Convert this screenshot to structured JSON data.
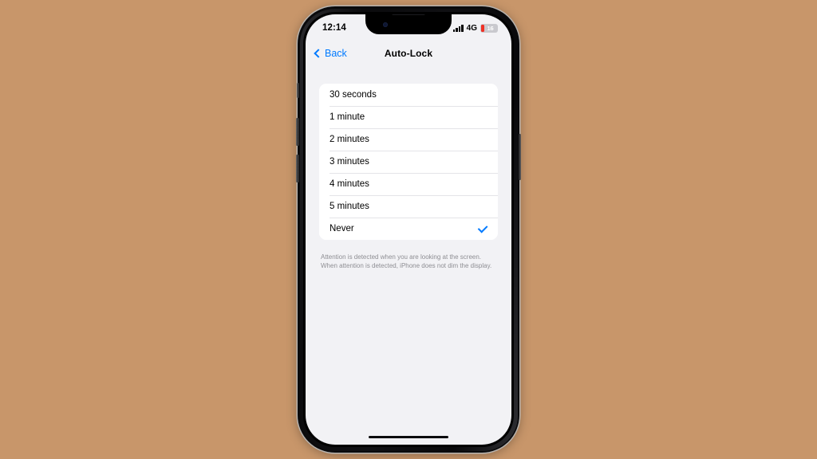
{
  "status_bar": {
    "time": "12:14",
    "signal_icon": "cellular-signal-icon",
    "network": "4G",
    "battery_percent": "16",
    "battery_fill_color": "#f03025"
  },
  "nav_bar": {
    "back_label": "Back",
    "back_icon": "chevron-left-icon",
    "title": "Auto-Lock",
    "accent_color": "#007aff"
  },
  "options": [
    {
      "label": "30 seconds",
      "selected": false
    },
    {
      "label": "1 minute",
      "selected": false
    },
    {
      "label": "2 minutes",
      "selected": false
    },
    {
      "label": "3 minutes",
      "selected": false
    },
    {
      "label": "4 minutes",
      "selected": false
    },
    {
      "label": "5 minutes",
      "selected": false
    },
    {
      "label": "Never",
      "selected": true
    }
  ],
  "footer": {
    "text": "Attention is detected when you are looking at the screen. When attention is detected, iPhone does not dim the display."
  },
  "device": {
    "home_indicator": "home-indicator",
    "notch": "notch",
    "buttons": [
      "silent-switch",
      "volume-up-button",
      "volume-down-button",
      "power-button"
    ]
  },
  "background_color": "#c8966a"
}
